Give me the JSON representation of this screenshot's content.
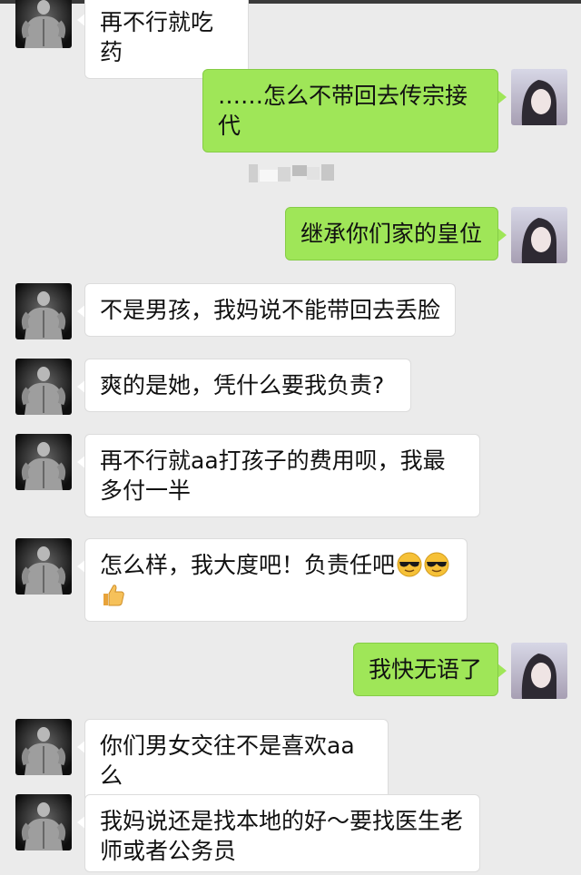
{
  "colors": {
    "background": "#ebebeb",
    "bubble_in": "#ffffff",
    "bubble_out": "#9fe658"
  },
  "messages": [
    {
      "side": "in",
      "text": "再不行就吃药"
    },
    {
      "side": "out",
      "text": "……怎么不带回去传宗接代"
    },
    {
      "side": "out",
      "text": "继承你们家的皇位"
    },
    {
      "side": "in",
      "text": "不是男孩，我妈说不能带回去丢脸"
    },
    {
      "side": "in",
      "text": "爽的是她，凭什么要我负责?"
    },
    {
      "side": "in",
      "text": "再不行就aa打孩子的费用呗，我最多付一半"
    },
    {
      "side": "in",
      "text": "怎么样，我大度吧！负责任吧",
      "emojis": [
        "sunglasses-emoji",
        "sunglasses-emoji",
        "thumbs-up-emoji"
      ]
    },
    {
      "side": "out",
      "text": "我快无语了"
    },
    {
      "side": "in",
      "text": "你们男女交往不是喜欢aa么"
    },
    {
      "side": "in",
      "text": "我妈说还是找本地的好～要找医生老师或者公务员"
    }
  ]
}
